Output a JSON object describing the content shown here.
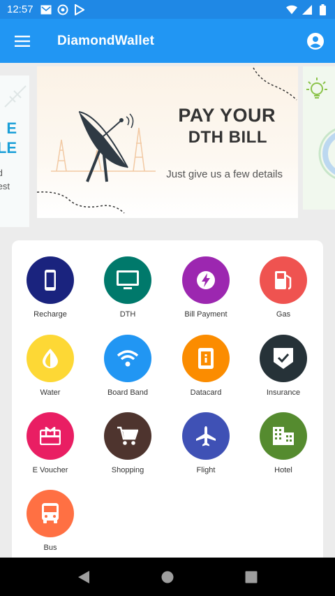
{
  "status_bar": {
    "time": "12:57",
    "left_icons": [
      "mail-icon",
      "at-sign-icon",
      "play-store-icon"
    ],
    "right_icons": [
      "wifi-icon",
      "signal-icon",
      "battery-icon"
    ]
  },
  "app_bar": {
    "title": "DiamondWallet",
    "color": "#2196f3"
  },
  "banners": {
    "left_partial": {
      "lines": [
        "E",
        "LE"
      ],
      "sub_lines": [
        "d",
        "est"
      ]
    },
    "main": {
      "title_line1": "PAY YOUR",
      "title_line2": "DTH BILL",
      "subtitle": "Just give us a few details"
    }
  },
  "services": [
    {
      "label": "Recharge",
      "icon": "mobile-icon",
      "color": "#1a237e"
    },
    {
      "label": "DTH",
      "icon": "tv-icon",
      "color": "#00796b"
    },
    {
      "label": "Bill Payment",
      "icon": "bolt-icon",
      "color": "#9c27b0"
    },
    {
      "label": "Gas",
      "icon": "fuel-icon",
      "color": "#ef5350"
    },
    {
      "label": "Water",
      "icon": "drop-icon",
      "color": "#fdd835"
    },
    {
      "label": "Board Band",
      "icon": "wifi-icon",
      "color": "#2196f3"
    },
    {
      "label": "Datacard",
      "icon": "datacard-icon",
      "color": "#fb8c00"
    },
    {
      "label": "Insurance",
      "icon": "shield-check-icon",
      "color": "#263238"
    },
    {
      "label": "E Voucher",
      "icon": "gift-card-icon",
      "color": "#e91e63"
    },
    {
      "label": "Shopping",
      "icon": "cart-icon",
      "color": "#4e342e"
    },
    {
      "label": "Flight",
      "icon": "plane-icon",
      "color": "#3f51b5"
    },
    {
      "label": "Hotel",
      "icon": "building-icon",
      "color": "#558b2f"
    },
    {
      "label": "Bus",
      "icon": "bus-icon",
      "color": "#ff7043"
    }
  ]
}
